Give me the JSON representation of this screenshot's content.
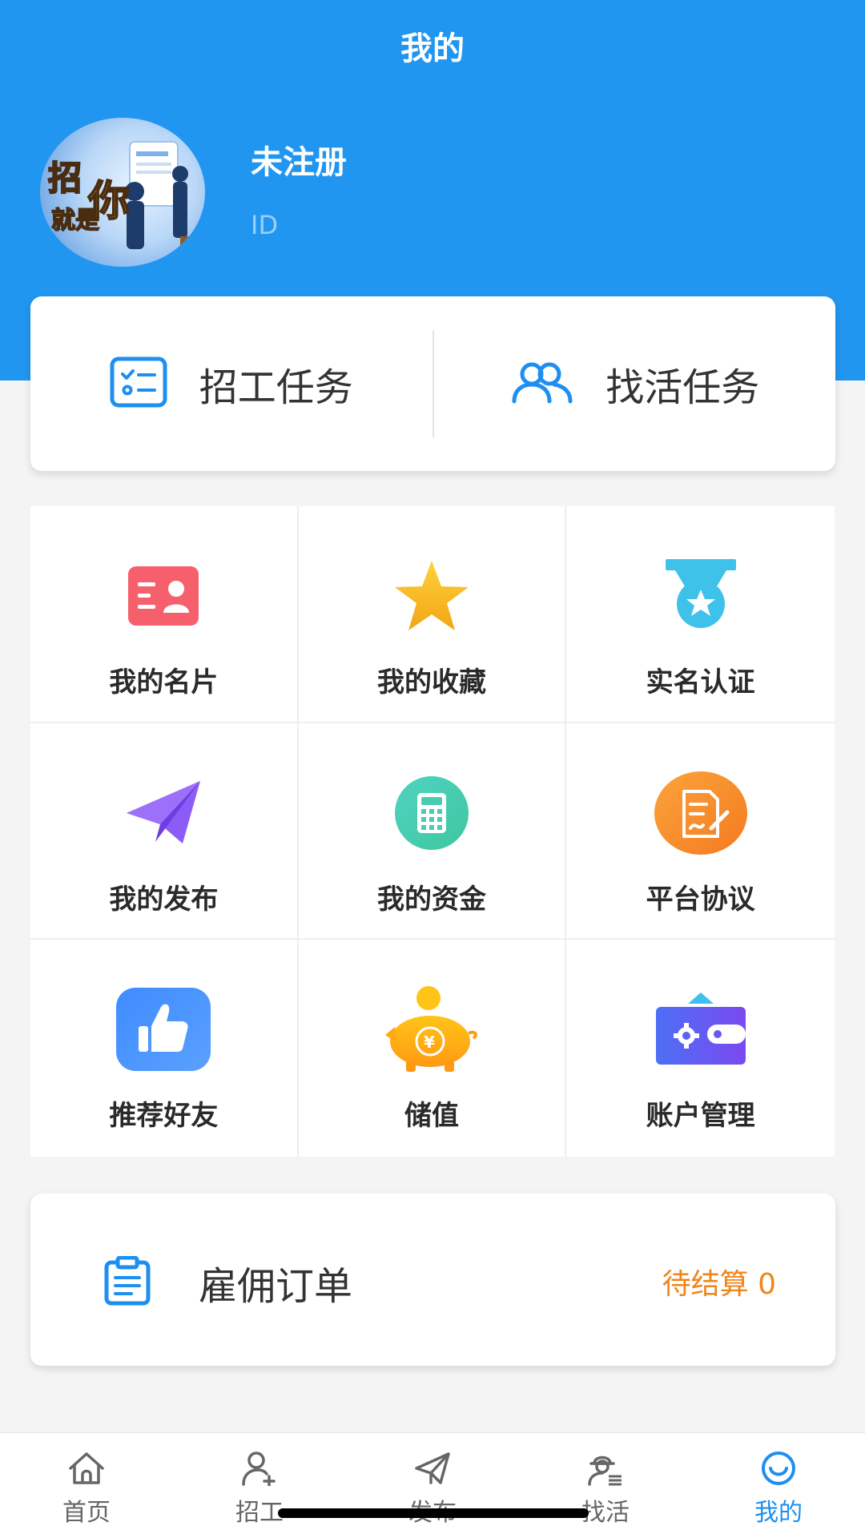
{
  "header": {
    "title": "我的",
    "user_name": "未注册",
    "user_id": "ID",
    "avatar_text": "招的就是你"
  },
  "tasks": [
    {
      "label": "招工任务",
      "icon": "checklist-icon"
    },
    {
      "label": "找活任务",
      "icon": "users-icon"
    }
  ],
  "menu": [
    {
      "label": "我的名片",
      "icon": "business-card-icon"
    },
    {
      "label": "我的收藏",
      "icon": "star-icon"
    },
    {
      "label": "实名认证",
      "icon": "medal-icon"
    },
    {
      "label": "我的发布",
      "icon": "paper-plane-icon"
    },
    {
      "label": "我的资金",
      "icon": "calculator-icon"
    },
    {
      "label": "平台协议",
      "icon": "document-sign-icon"
    },
    {
      "label": "推荐好友",
      "icon": "thumbs-up-icon"
    },
    {
      "label": "储值",
      "icon": "piggy-bank-icon"
    },
    {
      "label": "账户管理",
      "icon": "wallet-gear-icon"
    }
  ],
  "order": {
    "title": "雇佣订单",
    "status": "待结算 0"
  },
  "tabbar": [
    {
      "label": "首页",
      "icon": "home-icon"
    },
    {
      "label": "招工",
      "icon": "add-user-icon"
    },
    {
      "label": "发布",
      "icon": "send-icon"
    },
    {
      "label": "找活",
      "icon": "worker-icon"
    },
    {
      "label": "我的",
      "icon": "smile-icon",
      "active": true
    }
  ],
  "colors": {
    "primary": "#2196f0",
    "accent_orange": "#f08519",
    "active_tab": "#1e8ff0"
  }
}
